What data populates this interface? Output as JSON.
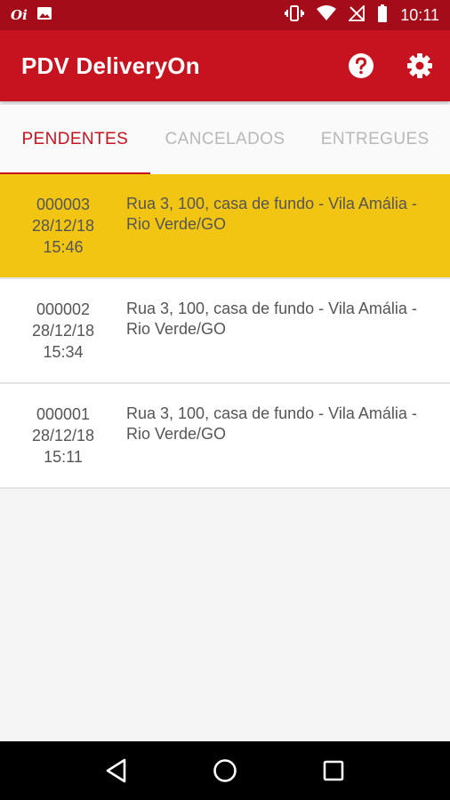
{
  "status_bar": {
    "carrier": "Oi",
    "time": "10:11",
    "icons": [
      "image-icon",
      "vibrate-icon",
      "wifi-icon",
      "no-signal-icon",
      "battery-icon"
    ]
  },
  "app_bar": {
    "title": "PDV DeliveryOn",
    "actions": [
      "help-icon",
      "settings-icon"
    ]
  },
  "tabs": [
    {
      "label": "PENDENTES",
      "active": true
    },
    {
      "label": "CANCELADOS",
      "active": false
    },
    {
      "label": "ENTREGUES",
      "active": false
    }
  ],
  "orders": [
    {
      "number": "000003",
      "date": "28/12/18",
      "time": "15:46",
      "address": "Rua 3, 100, casa de fundo - Vila Amália - Rio Verde/GO",
      "highlighted": true
    },
    {
      "number": "000002",
      "date": "28/12/18",
      "time": "15:34",
      "address": "Rua 3, 100, casa de fundo - Vila Amália - Rio Verde/GO",
      "highlighted": false
    },
    {
      "number": "000001",
      "date": "28/12/18",
      "time": "15:11",
      "address": "Rua 3, 100, casa de fundo - Vila Amália - Rio Verde/GO",
      "highlighted": false
    }
  ],
  "nav_bar": [
    "back-icon",
    "home-icon",
    "recents-icon"
  ],
  "colors": {
    "primary": "#c7121f",
    "status_bar": "#a50c19",
    "highlight": "#f2c512"
  }
}
